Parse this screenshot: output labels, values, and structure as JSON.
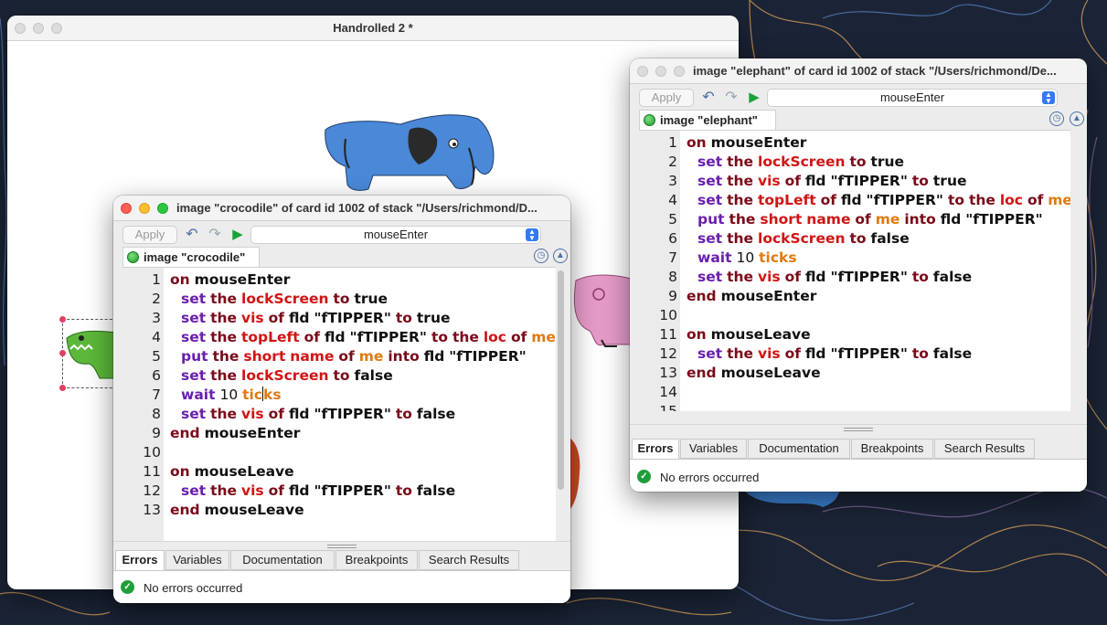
{
  "desktop": {
    "background_color": "#1b2436",
    "pattern_colors": [
      "#e0a45a",
      "#5a82c4",
      "#8a6ea8"
    ]
  },
  "stack_window": {
    "title": "Handrolled 2 *",
    "background_color": "#ffffff"
  },
  "crocodile_editor": {
    "title": "image \"crocodile\" of card id 1002 of stack \"/Users/richmond/D...",
    "apply_label": "Apply",
    "handler_select": "mouseEnter",
    "object_tab": "image \"crocodile\"",
    "lines": [
      {
        "n": "1"
      },
      {
        "n": "2"
      },
      {
        "n": "3"
      },
      {
        "n": "4"
      },
      {
        "n": "5"
      },
      {
        "n": "6"
      },
      {
        "n": "7"
      },
      {
        "n": "8"
      },
      {
        "n": "9"
      },
      {
        "n": "10"
      },
      {
        "n": "11"
      },
      {
        "n": "12"
      },
      {
        "n": "13"
      }
    ],
    "bottom_tabs": [
      "Errors",
      "Variables",
      "Documentation",
      "Breakpoints",
      "Search Results"
    ],
    "status": "No errors occurred"
  },
  "elephant_editor": {
    "title": "image \"elephant\" of card id 1002 of stack \"/Users/richmond/De...",
    "apply_label": "Apply",
    "handler_select": "mouseEnter",
    "object_tab": "image \"elephant\"",
    "lines": [
      {
        "n": "1"
      },
      {
        "n": "2"
      },
      {
        "n": "3"
      },
      {
        "n": "4"
      },
      {
        "n": "5"
      },
      {
        "n": "6"
      },
      {
        "n": "7"
      },
      {
        "n": "8"
      },
      {
        "n": "9"
      },
      {
        "n": "10"
      },
      {
        "n": "11"
      },
      {
        "n": "12"
      },
      {
        "n": "13"
      },
      {
        "n": "14"
      },
      {
        "n": "15"
      }
    ],
    "bottom_tabs": [
      "Errors",
      "Variables",
      "Documentation",
      "Breakpoints",
      "Search Results"
    ],
    "status": "No errors occurred"
  },
  "script": {
    "on": "on",
    "end": "end",
    "set": "set",
    "the": "the",
    "to": "to",
    "of": "of",
    "true": "true",
    "false": "false",
    "put": "put",
    "into": "into",
    "wait": "wait",
    "fld": "fld",
    "me": "me",
    "mouseEnter": "mouseEnter",
    "mouseLeave": "mouseLeave",
    "lockScreen": "lockScreen",
    "vis": "vis",
    "topLeft": "topLeft",
    "loc": "loc",
    "short": "short",
    "name": "name",
    "tipper": "\"fTIPPER\"",
    "ten": "10",
    "ticks": "ticks",
    "tic": "tic",
    "ks": "ks"
  },
  "colors": {
    "keyword": "#7a0a1a",
    "command": "#6a1fb0",
    "property": "#d11414",
    "constant": "#e07a10",
    "status_ok": "#1e9e3a",
    "accent": "#3478f6"
  }
}
